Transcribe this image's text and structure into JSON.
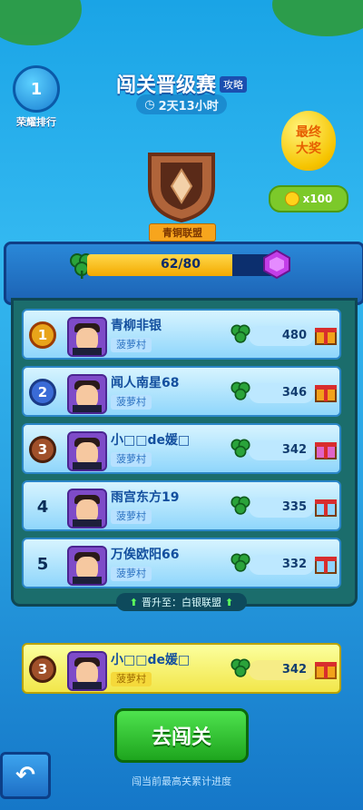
{
  "header": {
    "ranking_label": "荣耀排行",
    "ranking_icon_digit": "1",
    "title": "闯关晋级赛",
    "guide_label": "攻略",
    "timer": "2天13小时"
  },
  "reward": {
    "balloon_text": "最终\n大奖",
    "coins": "x100"
  },
  "league": {
    "name": "青铜联盟",
    "progress_text": "62/80",
    "progress_fraction": 0.775
  },
  "leaderboard": [
    {
      "rank": "1",
      "name": "青柳非银",
      "village": "菠萝村",
      "score": "480",
      "medal": "gold"
    },
    {
      "rank": "2",
      "name": "闻人南星68",
      "village": "菠萝村",
      "score": "346",
      "medal": "silver"
    },
    {
      "rank": "3",
      "name": "小□□de媛□",
      "village": "菠萝村",
      "score": "342",
      "medal": "bronze"
    },
    {
      "rank": "4",
      "name": "雨宫东方19",
      "village": "菠萝村",
      "score": "335",
      "medal": ""
    },
    {
      "rank": "5",
      "name": "万俟欧阳66",
      "village": "菠萝村",
      "score": "332",
      "medal": ""
    }
  ],
  "promotion_text": "晋升至：白银联盟",
  "me": {
    "rank": "3",
    "name": "小□□de媛□",
    "village": "菠萝村",
    "score": "342"
  },
  "go_button": "去闯关",
  "hint": "闯当前最高关累计进度",
  "colors": {
    "gold": "#f3a900",
    "silver": "#3a6bd6",
    "bronze": "#a0502a",
    "green": "#1ea51e"
  }
}
